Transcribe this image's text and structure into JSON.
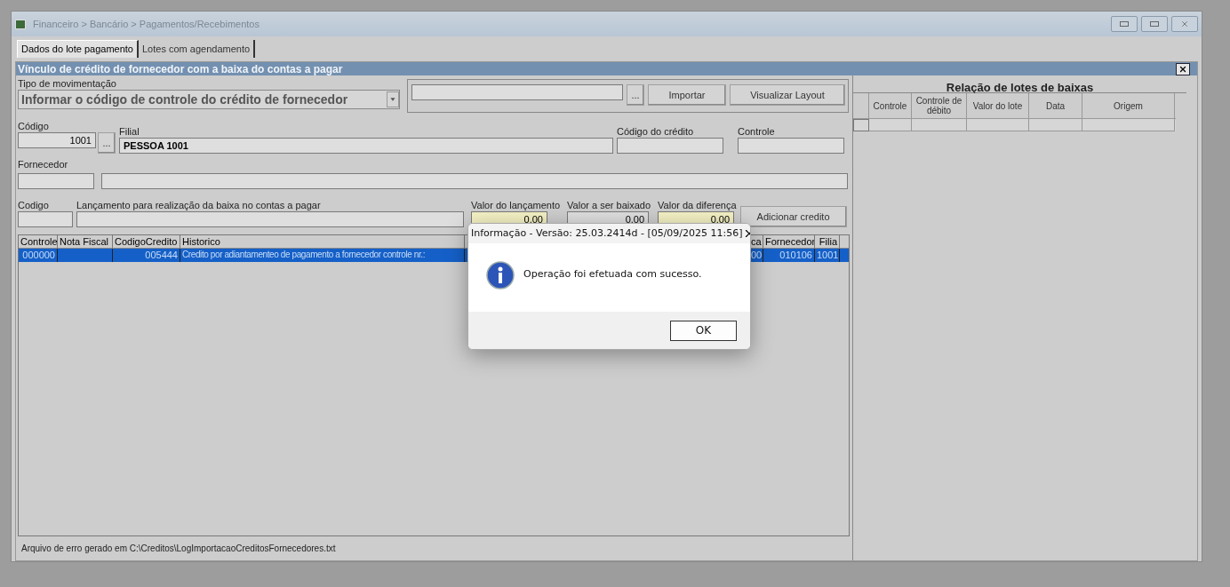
{
  "window": {
    "title": "Financeiro > Bancário > Pagamentos/Recebimentos"
  },
  "tabs": [
    {
      "label": "Dados do lote pagamento",
      "selected": true
    },
    {
      "label": "Lotes com agendamento",
      "selected": false
    }
  ],
  "panel": {
    "title": "Vínculo de crédito de fornecedor com a baixa do contas a pagar"
  },
  "form": {
    "tipo_label": "Tipo de  movimentação",
    "tipo_value": "Informar o código de controle do crédito de fornecedor",
    "browse_button": "...",
    "import_button": "Importar",
    "layout_button": "Visualizar Layout",
    "codigo_label": "Código",
    "codigo_value": "1001",
    "codigo_browse": "...",
    "filial_label": "Filial",
    "filial_value": "PESSOA 1001",
    "codigo_credito_label": "Código do crédito",
    "controle_label": "Controle",
    "fornecedor_label": "Fornecedor",
    "codigo2_label": "Codigo",
    "lancamento_label": "Lançamento para realização da baixa no contas a pagar",
    "valores": [
      {
        "label": "Valor do lançamento",
        "value": "0,00",
        "highlight": true
      },
      {
        "label": "Valor a ser baixado",
        "value": "0,00",
        "highlight": false
      },
      {
        "label": "Valor da diferença",
        "value": "0,00",
        "highlight": true
      }
    ],
    "add_button": "Adicionar credito"
  },
  "grid": {
    "columns": [
      "Controle",
      "Nota Fiscal",
      "CodigoCredito",
      "Historico",
      "ca",
      "Fornecedor",
      "Filia"
    ],
    "rows": [
      {
        "selected": true,
        "cells": [
          "000000",
          null,
          "005444",
          "Credito por adiantamenteo de pagamento a fornecedor controle nr.:",
          "00",
          "010106",
          "1001"
        ]
      }
    ]
  },
  "status": "Arquivo de erro gerado em C:\\Creditos\\LogImportacaoCreditosFornecedores.txt",
  "batches": {
    "title": "Relação de lotes de baixas",
    "columns": [
      "Controle",
      "Controle de débito",
      "Valor do lote",
      "Data",
      "Origem"
    ]
  },
  "dialog": {
    "title": "Informação - Versão: 25.03.2414d - [05/09/2025 11:56]",
    "message": "Operação foi efetuada com sucesso.",
    "ok_button": "OK"
  }
}
